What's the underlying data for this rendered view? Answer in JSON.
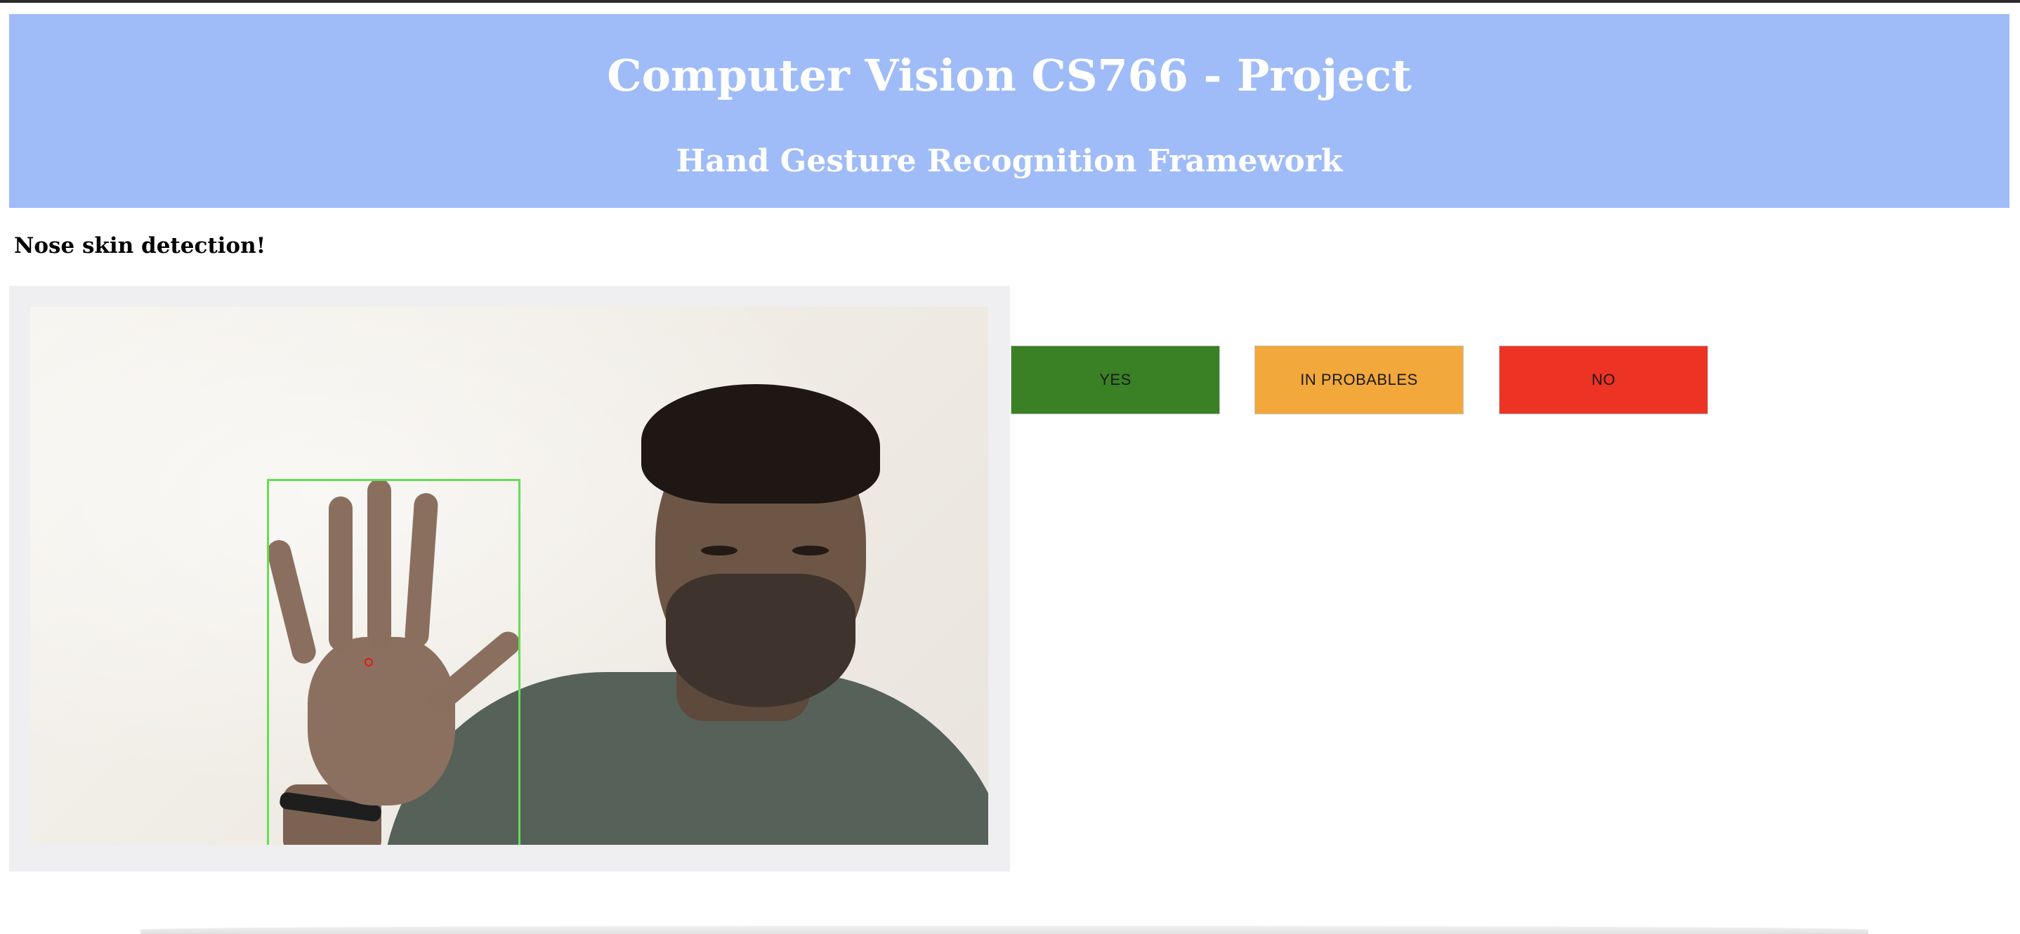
{
  "header": {
    "title": "Computer Vision CS766 - Project",
    "subtitle": "Hand Gesture Recognition Framework"
  },
  "status": {
    "message": "Nose skin detection!"
  },
  "video": {
    "detection_box_color": "#66dd55",
    "centroid_color": "#e01818"
  },
  "buttons": {
    "yes": {
      "label": "YES",
      "color": "#3a8025"
    },
    "probable": {
      "label": "IN PROBABLES",
      "color": "#f2a83b"
    },
    "no": {
      "label": "NO",
      "color": "#ec3324"
    }
  },
  "colors": {
    "header_background": "#9fbcf8",
    "panel_background": "#efeff1"
  }
}
